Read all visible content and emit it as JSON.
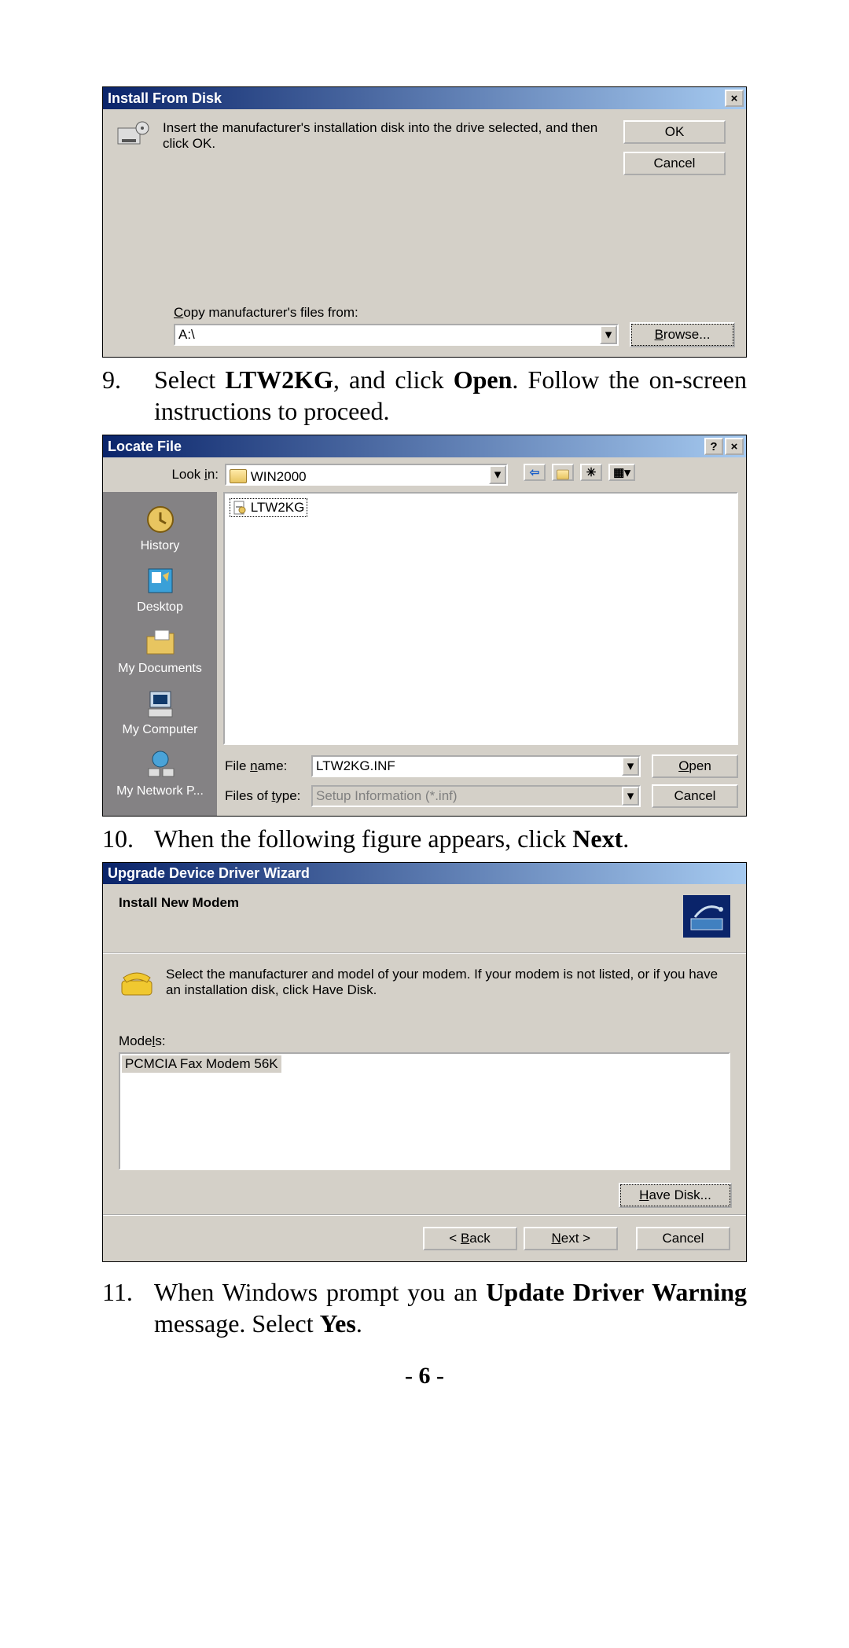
{
  "page_number": "- 6 -",
  "step9": {
    "num": "9.",
    "pre": "Select ",
    "bold1": "LTW2KG",
    "mid": ", and click ",
    "bold2": "Open",
    "post": ". Follow the on-screen instructions to proceed."
  },
  "step10": {
    "num": "10.",
    "pre": "When the following figure appears, click ",
    "bold1": "Next",
    "post": "."
  },
  "step11": {
    "num": "11.",
    "pre": "When Windows prompt you an ",
    "bold1": "Update Driver Warning",
    "mid": " message.  Select ",
    "bold2": "Yes",
    "post": "."
  },
  "dlg1": {
    "title": "Install From Disk",
    "msg": "Insert the manufacturer's installation disk into the drive selected, and then click OK.",
    "ok": "OK",
    "cancel": "Cancel",
    "copy_label_pre": "C",
    "copy_label_post": "opy manufacturer's files from:",
    "path": "A:\\",
    "browse_pre": "B",
    "browse_post": "rowse..."
  },
  "dlg2": {
    "title": "Locate File",
    "lookin_label_pre": "Look ",
    "lookin_label_u": "i",
    "lookin_label_post": "n:",
    "lookin_value": "WIN2000",
    "file_item": "LTW2KG",
    "sidebar": {
      "history": "History",
      "desktop": "Desktop",
      "mydocs": "My Documents",
      "mycomp": "My Computer",
      "mynet": "My Network P..."
    },
    "filename_label_pre": "File ",
    "filename_label_u": "n",
    "filename_label_post": "ame:",
    "filename_value": "LTW2KG.INF",
    "filetype_label_pre": "Files of ",
    "filetype_label_u": "t",
    "filetype_label_post": "ype:",
    "filetype_value": "Setup Information (*.inf)",
    "open_u": "O",
    "open_post": "pen",
    "cancel": "Cancel"
  },
  "dlg3": {
    "title": "Upgrade Device Driver Wizard",
    "heading": "Install New Modem",
    "msg": "Select the manufacturer and model of your modem. If your modem is not listed, or if you have an installation disk, click Have Disk.",
    "models_label_pre": "Mode",
    "models_label_u": "l",
    "models_label_post": "s:",
    "model_item": "PCMCIA Fax Modem 56K",
    "havedisk_u": "H",
    "havedisk_post": "ave Disk...",
    "back_pre": "< ",
    "back_u": "B",
    "back_post": "ack",
    "next_u": "N",
    "next_post": "ext >",
    "cancel": "Cancel"
  }
}
